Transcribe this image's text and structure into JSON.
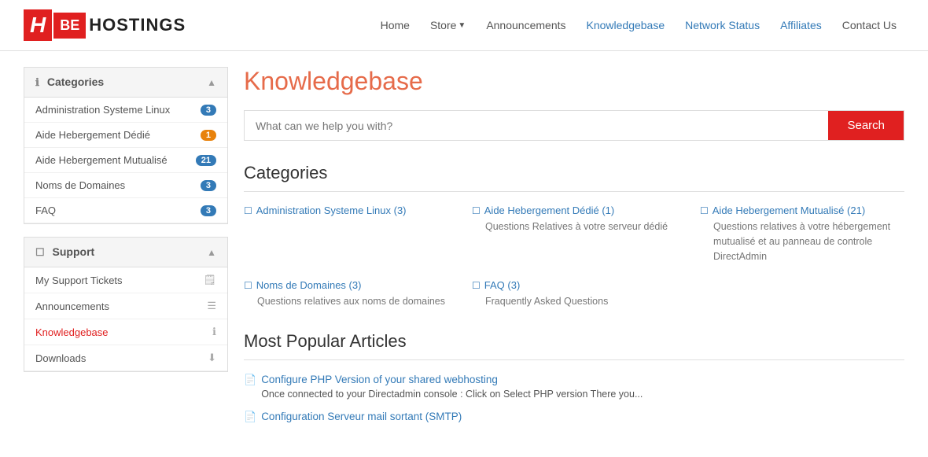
{
  "logo": {
    "h": "H",
    "be": "BE",
    "text": "HOSTINGS"
  },
  "nav": {
    "home": "Home",
    "store": "Store",
    "announcements": "Announcements",
    "knowledgebase": "Knowledgebase",
    "network_status": "Network Status",
    "affiliates": "Affiliates",
    "contact_us": "Contact Us"
  },
  "sidebar": {
    "categories_title": "Categories",
    "support_title": "Support",
    "categories": [
      {
        "label": "Administration Systeme Linux",
        "count": 3
      },
      {
        "label": "Aide Hebergement Dédié",
        "count": 1
      },
      {
        "label": "Aide Hebergement Mutualisé",
        "count": 21
      },
      {
        "label": "Noms de Domaines",
        "count": 3
      },
      {
        "label": "FAQ",
        "count": 3
      }
    ],
    "support_items": [
      {
        "label": "My Support Tickets",
        "icon": "🗒"
      },
      {
        "label": "Announcements",
        "icon": "☰"
      },
      {
        "label": "Knowledgebase",
        "icon": "ℹ",
        "active": true
      },
      {
        "label": "Downloads",
        "icon": "⬇"
      }
    ]
  },
  "main": {
    "page_title": "Knowledgebase",
    "search_placeholder": "What can we help you with?",
    "search_button": "Search",
    "categories_title": "Categories",
    "categories": [
      {
        "link": "Administration Systeme Linux (3)",
        "desc": ""
      },
      {
        "link": "Aide Hebergement Dédié (1)",
        "desc": "Questions Relatives à votre serveur dédié"
      },
      {
        "link": "Aide Hebergement Mutualisé (21)",
        "desc": "Questions relatives à votre hébergement mutualisé et au panneau de controle DirectAdmin"
      },
      {
        "link": "Noms de Domaines (3)",
        "desc": "Questions relatives aux noms de domaines"
      },
      {
        "link": "FAQ (3)",
        "desc": "Fraquently Asked Questions"
      }
    ],
    "popular_title": "Most Popular Articles",
    "articles": [
      {
        "title": "Configure PHP Version of your shared webhosting",
        "desc": "Once connected to your Directadmin console : Click on  Select PHP version There you..."
      },
      {
        "title": "Configuration Serveur mail sortant (SMTP)",
        "desc": ""
      }
    ]
  }
}
